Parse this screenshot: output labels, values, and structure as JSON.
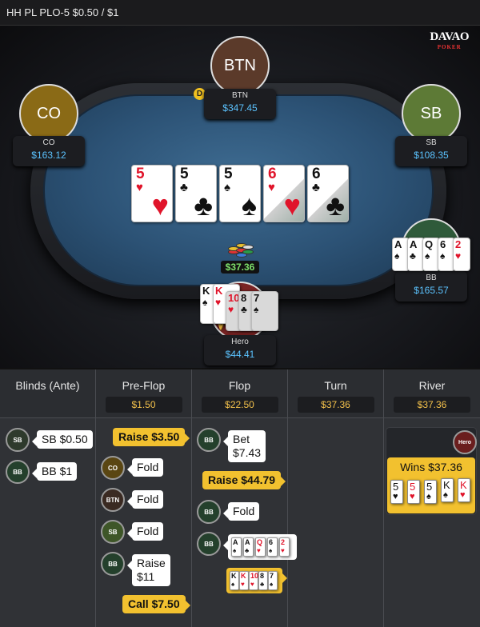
{
  "title": "HH PL PLO-5 $0.50 / $1",
  "logo": {
    "text": "DAVAO",
    "sub": "POKER"
  },
  "seats": {
    "btn": {
      "avatar": "BTN",
      "name": "BTN",
      "stack": "$347.45",
      "color": "#5b3a2a"
    },
    "co": {
      "avatar": "CO",
      "name": "CO",
      "stack": "$163.12",
      "color": "#8a6a16"
    },
    "sb": {
      "avatar": "SB",
      "name": "SB",
      "stack": "$108.35",
      "color": "#5d7a36"
    },
    "bb": {
      "name": "BB",
      "stack": "$165.57",
      "color": "#2f5a3a"
    },
    "hero": {
      "name": "Hero",
      "stack": "$44.41",
      "color": "#7a2424"
    }
  },
  "dealer": "D",
  "board": [
    {
      "rank": "5",
      "suit": "♥",
      "color": "red"
    },
    {
      "rank": "5",
      "suit": "♣",
      "color": "blk"
    },
    {
      "rank": "5",
      "suit": "♠",
      "color": "blk"
    },
    {
      "rank": "6",
      "suit": "♥",
      "color": "red"
    },
    {
      "rank": "6",
      "suit": "♣",
      "color": "blk"
    }
  ],
  "pot": "$37.36",
  "win_text": "WIN",
  "bb_hand": [
    {
      "rank": "A",
      "suit": "♠",
      "color": "blk"
    },
    {
      "rank": "A",
      "suit": "♣",
      "color": "blk"
    },
    {
      "rank": "Q",
      "suit": "♠",
      "color": "blk"
    },
    {
      "rank": "6",
      "suit": "♠",
      "color": "blk"
    },
    {
      "rank": "2",
      "suit": "♥",
      "color": "red"
    }
  ],
  "hero_hand": [
    {
      "rank": "K",
      "suit": "♠",
      "color": "blk"
    },
    {
      "rank": "K",
      "suit": "♥",
      "color": "red"
    },
    {
      "rank": "10",
      "suit": "♥",
      "color": "red"
    },
    {
      "rank": "8",
      "suit": "♣",
      "color": "blk"
    },
    {
      "rank": "7",
      "suit": "♠",
      "color": "blk"
    }
  ],
  "streets": [
    {
      "name": "Blinds (Ante)",
      "pot": ""
    },
    {
      "name": "Pre-Flop",
      "pot": "$1.50"
    },
    {
      "name": "Flop",
      "pot": "$22.50"
    },
    {
      "name": "Turn",
      "pot": "$37.36"
    },
    {
      "name": "River",
      "pot": "$37.36"
    }
  ],
  "actions": {
    "blinds": [
      {
        "pos": "SB",
        "text": "SB $0.50"
      },
      {
        "pos": "BB",
        "text": "BB $1"
      }
    ],
    "preflop": {
      "hero_raise": "Raise $3.50",
      "co": {
        "pos": "CO",
        "text": "Fold"
      },
      "btn": {
        "pos": "BTN",
        "text": "Fold"
      },
      "sb": {
        "pos": "SB",
        "text": "Fold"
      },
      "bb": {
        "pos": "BB",
        "text": "Raise\n$11"
      },
      "hero_call": "Call $7.50"
    },
    "flop": {
      "bb_bet": {
        "pos": "BB",
        "text": "Bet\n$7.43"
      },
      "hero_raise": "Raise $44.79",
      "bb_fold": {
        "pos": "BB",
        "text": "Fold"
      },
      "bb_show": {
        "pos": "BB"
      },
      "bb_cards": [
        {
          "rank": "A",
          "suit": "♠",
          "color": "blk"
        },
        {
          "rank": "A",
          "suit": "♣",
          "color": "blk"
        },
        {
          "rank": "Q",
          "suit": "♥",
          "color": "red"
        },
        {
          "rank": "6",
          "suit": "♠",
          "color": "blk"
        },
        {
          "rank": "2",
          "suit": "♥",
          "color": "red"
        }
      ],
      "hero_cards": [
        {
          "rank": "K",
          "suit": "♠",
          "color": "blk"
        },
        {
          "rank": "K",
          "suit": "♥",
          "color": "red"
        },
        {
          "rank": "10",
          "suit": "♥",
          "color": "red"
        },
        {
          "rank": "8",
          "suit": "♣",
          "color": "blk"
        },
        {
          "rank": "7",
          "suit": "♠",
          "color": "blk"
        }
      ]
    },
    "river": {
      "pos": "Hero",
      "wins": "Wins $37.36",
      "cards": [
        {
          "rank": "5",
          "suit": "♥",
          "color": "blk"
        },
        {
          "rank": "5",
          "suit": "♥",
          "color": "red"
        },
        {
          "rank": "5",
          "suit": "♠",
          "color": "blk"
        },
        {
          "rank": "K",
          "suit": "♠",
          "color": "blk"
        },
        {
          "rank": "K",
          "suit": "♥",
          "color": "red"
        }
      ]
    }
  }
}
